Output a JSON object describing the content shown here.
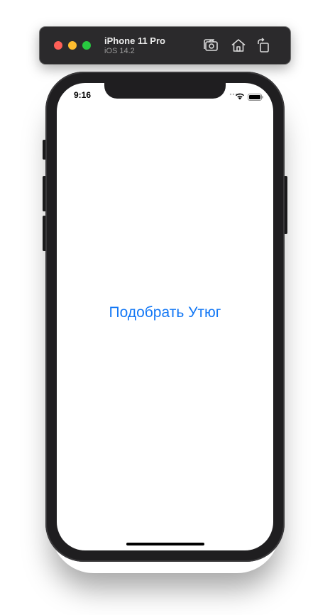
{
  "titlebar": {
    "device_name": "iPhone 11 Pro",
    "os_version": "iOS 14.2",
    "buttons": [
      "screenshot-icon",
      "home-icon",
      "rotate-icon"
    ]
  },
  "status_bar": {
    "time": "9:16",
    "icons": [
      "signal-icon",
      "wifi-icon",
      "battery-icon"
    ]
  },
  "main": {
    "button_label": "Подобрать Утюг"
  },
  "colors": {
    "accent": "#1478f5",
    "titlebar_bg": "#2b2a2c",
    "device_frame": "#1f1e20",
    "close": "#fe5f57",
    "minimize": "#febc2e",
    "maximize": "#28c840"
  }
}
